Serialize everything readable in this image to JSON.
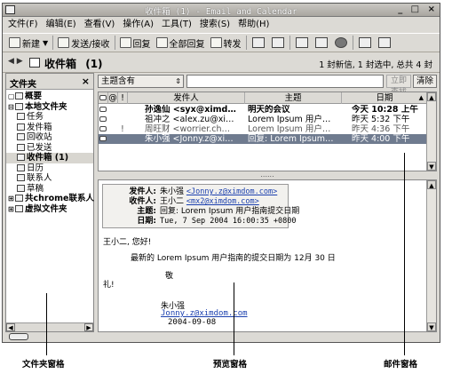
{
  "window": {
    "title": "收件箱 (1) - Email and Calendar",
    "controls": "_ □ ×"
  },
  "menu": [
    "文件(F)",
    "编辑(E)",
    "查看(V)",
    "操作(A)",
    "工具(T)",
    "搜索(S)",
    "帮助(H)"
  ],
  "toolbar": {
    "new_label": "新建",
    "send_receive_label": "发送/接收",
    "reply_label": "回复",
    "reply_all_label": "全部回复",
    "forward_label": "转发",
    "icons": [
      "move-icon",
      "copy-icon",
      "print-icon",
      "trash-icon",
      "stop-icon",
      "prev-icon",
      "next-icon"
    ]
  },
  "folderbar": {
    "folder_name": "收件箱",
    "count": "(1)",
    "status": "1 封新信, 1 封选中, 总共 4 封"
  },
  "folder_pane": {
    "title": "文件夹",
    "close": "×",
    "tree": [
      {
        "label": "概要",
        "indent": 0,
        "bold": true,
        "exp": "▢"
      },
      {
        "label": "本地文件夹",
        "indent": 0,
        "bold": true,
        "exp": "⊟"
      },
      {
        "label": "任务",
        "indent": 1
      },
      {
        "label": "发件箱",
        "indent": 1
      },
      {
        "label": "回收站",
        "indent": 1
      },
      {
        "label": "已发送",
        "indent": 1
      },
      {
        "label": "收件箱 (1)",
        "indent": 1,
        "bold": true,
        "selected": true
      },
      {
        "label": "日历",
        "indent": 1
      },
      {
        "label": "联系人",
        "indent": 1
      },
      {
        "label": "草稿",
        "indent": 1
      },
      {
        "label": "共chrome联系人",
        "indent": 0,
        "bold": true,
        "exp": "⊞"
      },
      {
        "label": "虚拟文件夹",
        "indent": 0,
        "bold": true,
        "exp": "⊞"
      }
    ]
  },
  "search": {
    "scope": "主题含有",
    "find_label": "立即查找",
    "clear_label": "清除"
  },
  "message_list": {
    "columns": [
      "发件人",
      "主题",
      "日期"
    ],
    "rows": [
      {
        "from": "孙逸仙 <syx@ximd…",
        "subject": "明天的会议",
        "date": "今天 10:28 上午",
        "style": "bold"
      },
      {
        "from": "祖冲之 <alex.zu@xi…",
        "subject": "Lorem Ipsum 用户…",
        "date": "昨天 5:32 下午",
        "style": "normal"
      },
      {
        "from": "周旺财 <worrier.ch…",
        "subject": "Lorem Ipsum 用户…",
        "date": "昨天 4:36 下午",
        "style": "grey",
        "flag": "!"
      },
      {
        "from": "朱小强 <Jonny.z@xi…",
        "subject": "回复: Lorem Ipsum…",
        "date": "昨天 4:00 下午",
        "style": "sel"
      }
    ]
  },
  "preview": {
    "from_key": "发件人:",
    "from_val": "朱小强",
    "from_mail": "<Jonny.z@ximdom.com>",
    "to_key": "收件人:",
    "to_val": "王小二",
    "to_mail": "<mx2@ximdom.com>",
    "subject_key": "主题:",
    "subject_val": "回复: Lorem Ipsum 用户指南提交日期",
    "date_key": "日期:",
    "date_val": "Tue, 7 Sep 2004 16:00:35 +0800",
    "greeting": "王小二, 您好!",
    "body": "最新的 Lorem Ipsum 用户指南的提交日期为 12月 30 日",
    "closing1": "敬",
    "closing2": "礼!",
    "sign_name": "朱小强",
    "sign_mail": "Jonny.z@ximdom.com",
    "sign_date": "2004-09-08"
  },
  "callouts": {
    "folder_pane": "文件夹窗格",
    "preview_pane": "预览窗格",
    "mail_pane": "邮件窗格"
  }
}
